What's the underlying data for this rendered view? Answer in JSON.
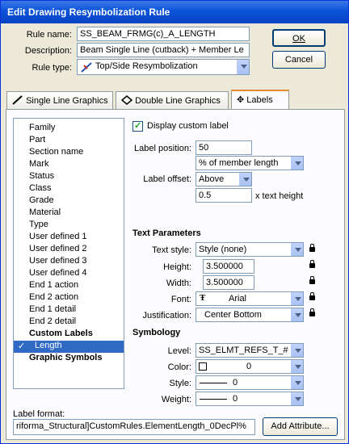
{
  "window": {
    "title": "Edit Drawing Resymbolization Rule"
  },
  "header": {
    "rule_name_label": "Rule name:",
    "rule_name_value": "SS_BEAM_FRMG(c)_A_LENGTH",
    "description_label": "Description:",
    "description_value": "Beam Single Line (cutback) + Member Le",
    "rule_type_label": "Rule type:",
    "rule_type_value": "Top/Side Resymbolization",
    "ok_label": "OK",
    "cancel_label": "Cancel"
  },
  "tabs": [
    {
      "label": "Single Line Graphics",
      "icon": "pen-icon"
    },
    {
      "label": "Double Line Graphics",
      "icon": "diamond-icon"
    },
    {
      "label": "Labels",
      "icon": "label-icon"
    }
  ],
  "list": {
    "items": [
      {
        "label": "Family",
        "bold": false
      },
      {
        "label": "Part",
        "bold": false
      },
      {
        "label": "Section name",
        "bold": false
      },
      {
        "label": "Mark",
        "bold": false
      },
      {
        "label": "Status",
        "bold": false
      },
      {
        "label": "Class",
        "bold": false
      },
      {
        "label": "Grade",
        "bold": false
      },
      {
        "label": "Material",
        "bold": false
      },
      {
        "label": "Type",
        "bold": false
      },
      {
        "label": "User defined 1",
        "bold": false
      },
      {
        "label": "User defined 2",
        "bold": false
      },
      {
        "label": "User defined 3",
        "bold": false
      },
      {
        "label": "User defined 4",
        "bold": false
      },
      {
        "label": "End 1 action",
        "bold": false
      },
      {
        "label": "End 2 action",
        "bold": false
      },
      {
        "label": "End 1 detail",
        "bold": false
      },
      {
        "label": "End 2 detail",
        "bold": false
      },
      {
        "label": "Custom Labels",
        "bold": true
      },
      {
        "label": "Length",
        "bold": false,
        "selected": true,
        "checked": true
      },
      {
        "label": "Graphic Symbols",
        "bold": true
      }
    ]
  },
  "label_options": {
    "display_custom_label": "Display custom label",
    "label_position_label": "Label position:",
    "label_position_value": "50",
    "position_unit": "% of member length",
    "label_offset_label": "Label offset:",
    "label_offset_value": "Above",
    "offset_value": "0.5",
    "offset_unit": "x text height"
  },
  "text_parameters": {
    "heading": "Text Parameters",
    "text_style_label": "Text style:",
    "text_style_value": "Style (none)",
    "height_label": "Height:",
    "height_value": "3.500000",
    "width_label": "Width:",
    "width_value": "3.500000",
    "font_label": "Font:",
    "font_value": "Arial",
    "justification_label": "Justification:",
    "justification_value": "Center Bottom"
  },
  "symbology": {
    "heading": "Symbology",
    "level_label": "Level:",
    "level_value": "SS_ELMT_REFS_T_#",
    "color_label": "Color:",
    "color_value": "0",
    "style_label": "Style:",
    "style_value": "0",
    "weight_label": "Weight:",
    "weight_value": "0"
  },
  "footer": {
    "label_format_label": "Label format:",
    "label_format_value": "riforma_Structural]CustomRules.ElementLength_0DecPl%",
    "add_attribute_label": "Add Attribute..."
  }
}
